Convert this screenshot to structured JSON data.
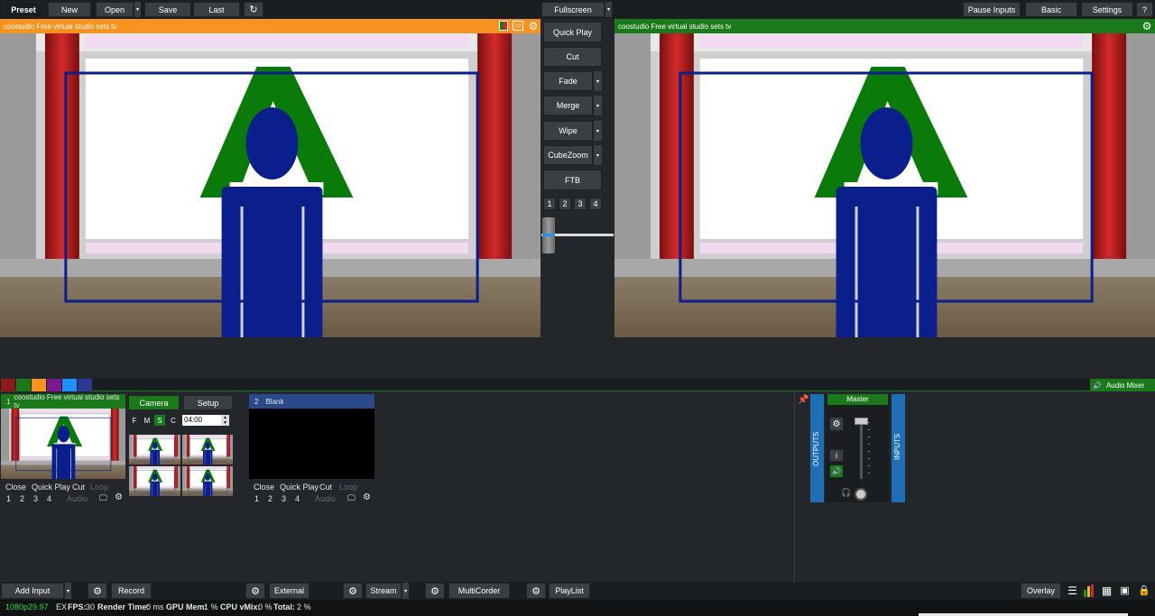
{
  "toolbar": {
    "preset": "Preset",
    "new": "New",
    "open": "Open",
    "save": "Save",
    "last": "Last",
    "fullscreen": "Fullscreen",
    "pause_inputs": "Pause Inputs",
    "basic": "Basic",
    "settings": "Settings",
    "help": "?"
  },
  "preview": {
    "title": "coostudio Free virtual studio sets tv",
    "color": "#f7931e"
  },
  "output": {
    "title": "coostudio Free virtual studio sets tv",
    "color": "#1a7a1a"
  },
  "transitions": {
    "quick_play": "Quick Play",
    "cut": "Cut",
    "fade": "Fade",
    "merge": "Merge",
    "wipe": "Wipe",
    "cubezoom": "CubeZoom",
    "ftb": "FTB",
    "numbers": [
      "1",
      "2",
      "3",
      "4"
    ]
  },
  "color_swatches": [
    "#8b1a1a",
    "#1a7a1a",
    "#f7931e",
    "#7a1a8b",
    "#1e90ff",
    "#2b3990"
  ],
  "audio_mixer_label": "Audio Mixer",
  "input1": {
    "num": "1",
    "title": "coostudio Free virtual studio sets tv",
    "camera": "Camera",
    "setup": "Setup",
    "modes": [
      "F",
      "M",
      "S",
      "C"
    ],
    "time": "04:00",
    "actions": [
      "Close",
      "Quick Play",
      "Cut",
      "Loop"
    ],
    "numbers": [
      "1",
      "2",
      "3",
      "4"
    ],
    "audio": "Audio"
  },
  "input2": {
    "num": "2",
    "title": "Blank",
    "actions": [
      "Close",
      "Quick Play",
      "Cut",
      "Loop"
    ],
    "numbers": [
      "1",
      "2",
      "3",
      "4"
    ],
    "audio": "Audio"
  },
  "mixer": {
    "outputs": "OUTPUTS",
    "inputs": "INPUTS",
    "master": "Master",
    "info": "i"
  },
  "bottombar": {
    "add_input": "Add Input",
    "record": "Record",
    "external": "External",
    "stream": "Stream",
    "multicorder": "MultiCorder",
    "playlist": "PlayList",
    "overlay": "Overlay"
  },
  "status": {
    "format": "1080p29.97",
    "ex": "EX",
    "fps_label": "FPS:",
    "fps": "30",
    "render_label": "Render Time:",
    "render": "0 ms",
    "gpu_label": "GPU Mem:",
    "gpu": "1 %",
    "cpu_label": "CPU vMix:",
    "cpu": "0 %",
    "total_label": "Total:",
    "total": "2 %"
  }
}
